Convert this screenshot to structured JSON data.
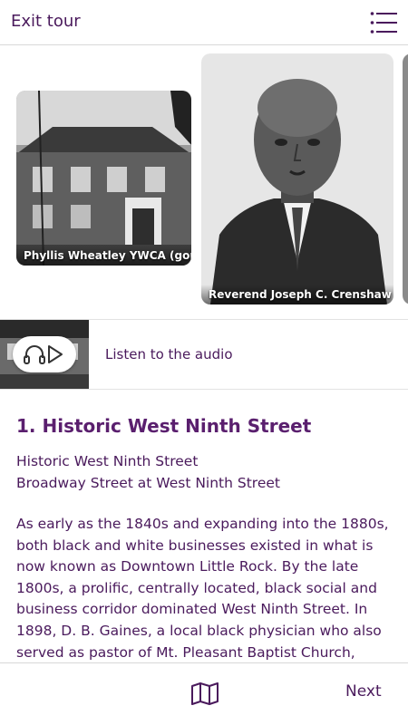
{
  "header": {
    "exit_label": "Exit tour",
    "menu_icon": "list-menu-icon"
  },
  "carousel": {
    "photos": [
      {
        "caption": "Phyllis Wheatley YWCA (gone)"
      },
      {
        "caption": "Reverend Joseph C. Crenshaw"
      }
    ]
  },
  "audio": {
    "label": "Listen to the audio",
    "icons": [
      "headphones-icon",
      "play-icon"
    ]
  },
  "stop": {
    "title": "1. Historic West Ninth Street",
    "subtitle_line1": "Historic West Ninth Street",
    "subtitle_line2": "Broadway Street at West Ninth Street",
    "body": "As early as the 1840s and expanding into the 1880s, both black and white businesses existed in what is now known as Downtown Little Rock. By the late 1800s, a prolific, centrally located, black social and business corridor dominated West Ninth Street. In 1898, D. B. Gaines, a local black physician who also served as pastor of Mt. Pleasant Baptist Church,"
  },
  "footer": {
    "map_icon": "map-icon",
    "next_label": "Next"
  },
  "colors": {
    "accent": "#4a1a5c",
    "divider": "#d8d8d8"
  }
}
